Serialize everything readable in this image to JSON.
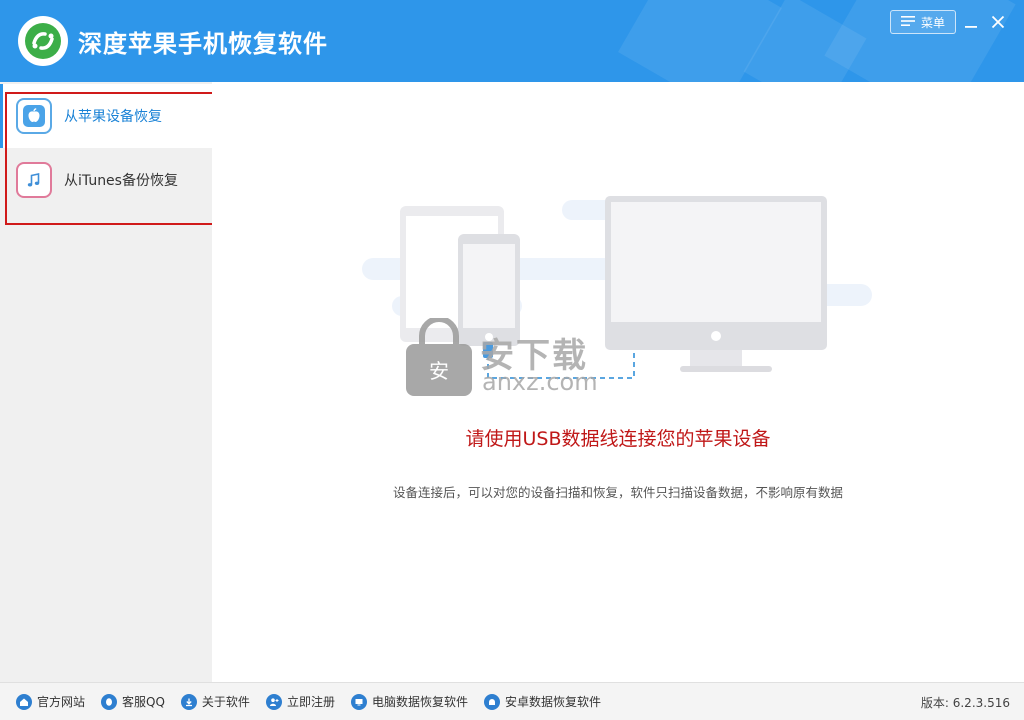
{
  "app": {
    "title": "深度苹果手机恢复软件"
  },
  "titlebar": {
    "menu_label": "菜单"
  },
  "sidebar": {
    "items": [
      {
        "label": "从苹果设备恢复",
        "icon": "apple-icon",
        "active": true
      },
      {
        "label": "从iTunes备份恢复",
        "icon": "itunes-music-icon",
        "active": false
      }
    ]
  },
  "main": {
    "prompt": "请使用USB数据线连接您的苹果设备",
    "subtext": "设备连接后，可以对您的设备扫描和恢复，软件只扫描设备数据，不影响原有数据"
  },
  "watermark": {
    "text": "安下载",
    "sub": "anxz.com"
  },
  "footer": {
    "links": [
      {
        "label": "官方网站",
        "icon": "home-icon"
      },
      {
        "label": "客服QQ",
        "icon": "qq-icon"
      },
      {
        "label": "关于软件",
        "icon": "info-icon"
      },
      {
        "label": "立即注册",
        "icon": "register-icon"
      },
      {
        "label": "电脑数据恢复软件",
        "icon": "computer-icon"
      },
      {
        "label": "安卓数据恢复软件",
        "icon": "android-icon"
      }
    ],
    "version": "版本: 6.2.3.516"
  },
  "colors": {
    "accent": "#2e96ea",
    "prompt_red": "#c01818",
    "highlight_box": "#d01a1a"
  }
}
